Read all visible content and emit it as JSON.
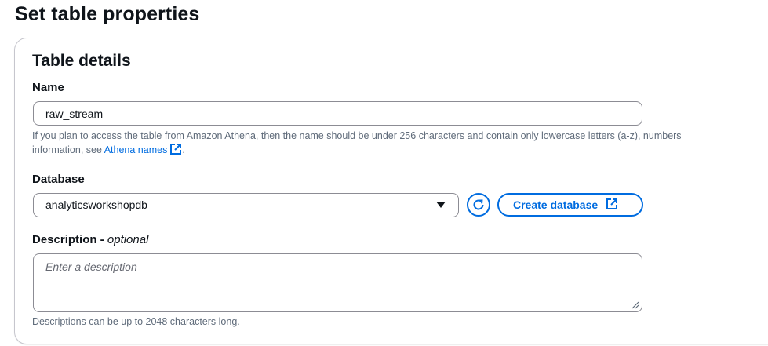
{
  "page": {
    "title": "Set table properties"
  },
  "panel": {
    "title": "Table details"
  },
  "name_field": {
    "label": "Name",
    "value": "raw_stream",
    "hint_line1": "If you plan to access the table from Amazon Athena, then the name should be under 256 characters and contain only lowercase letters (a-z), numbers",
    "hint_line2_prefix": "information, see ",
    "hint_link": "Athena names",
    "hint_line2_suffix": ".",
    "link_icon": "external-link-icon"
  },
  "database_field": {
    "label": "Database",
    "selected": "analyticsworkshopdb",
    "refresh_icon": "refresh-icon",
    "create_button": "Create database",
    "create_icon": "external-link-icon"
  },
  "description_field": {
    "label": "Description - ",
    "label_optional": "optional",
    "placeholder": "Enter a description",
    "hint": "Descriptions can be up to 2048 characters long."
  },
  "colors": {
    "accent": "#006ce0",
    "border": "#8c8c94",
    "hint_text": "#5f6b7a",
    "heading": "#0f141a"
  }
}
